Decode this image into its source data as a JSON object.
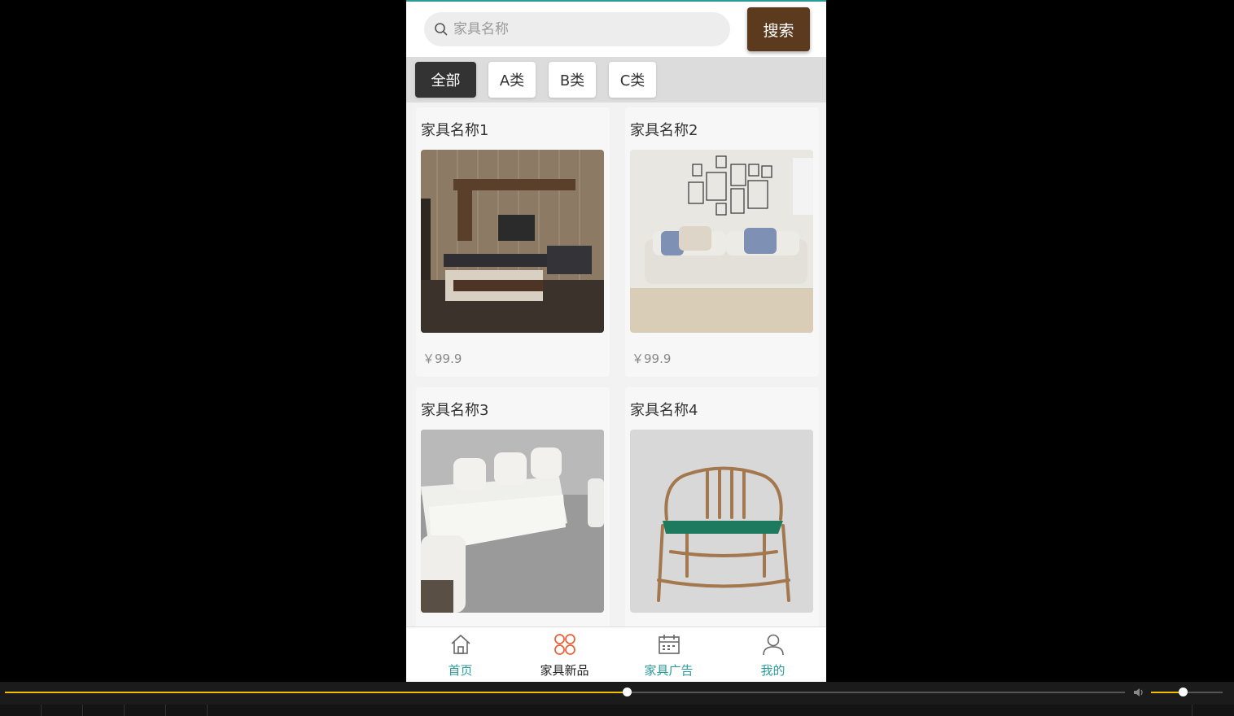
{
  "search": {
    "placeholder": "家具名称",
    "button_label": "搜索"
  },
  "categories": [
    {
      "label": "全部",
      "active": true
    },
    {
      "label": "A类",
      "active": false
    },
    {
      "label": "B类",
      "active": false
    },
    {
      "label": "C类",
      "active": false
    }
  ],
  "products": [
    {
      "name": "家具名称1",
      "price": "￥99.9",
      "image": "tv-cabinet-living-room"
    },
    {
      "name": "家具名称2",
      "price": "￥99.9",
      "image": "white-sofa-gallery-wall"
    },
    {
      "name": "家具名称3",
      "price": "",
      "image": "white-sectional-sofa"
    },
    {
      "name": "家具名称4",
      "price": "",
      "image": "wooden-armchair"
    }
  ],
  "tabbar": [
    {
      "label": "首页",
      "icon": "home-icon",
      "active": false
    },
    {
      "label": "家具新品",
      "icon": "clover-icon",
      "active": true
    },
    {
      "label": "家具广告",
      "icon": "calendar-icon",
      "active": false
    },
    {
      "label": "我的",
      "icon": "user-icon",
      "active": false
    }
  ],
  "player": {
    "progress": 0.555,
    "volume": 0.44
  },
  "colors": {
    "accent": "#2a9a9a",
    "search_button": "#5b3a1e",
    "active_category": "#333333",
    "tab_active_icon": "#e8643c",
    "seek": "#f0c000"
  }
}
